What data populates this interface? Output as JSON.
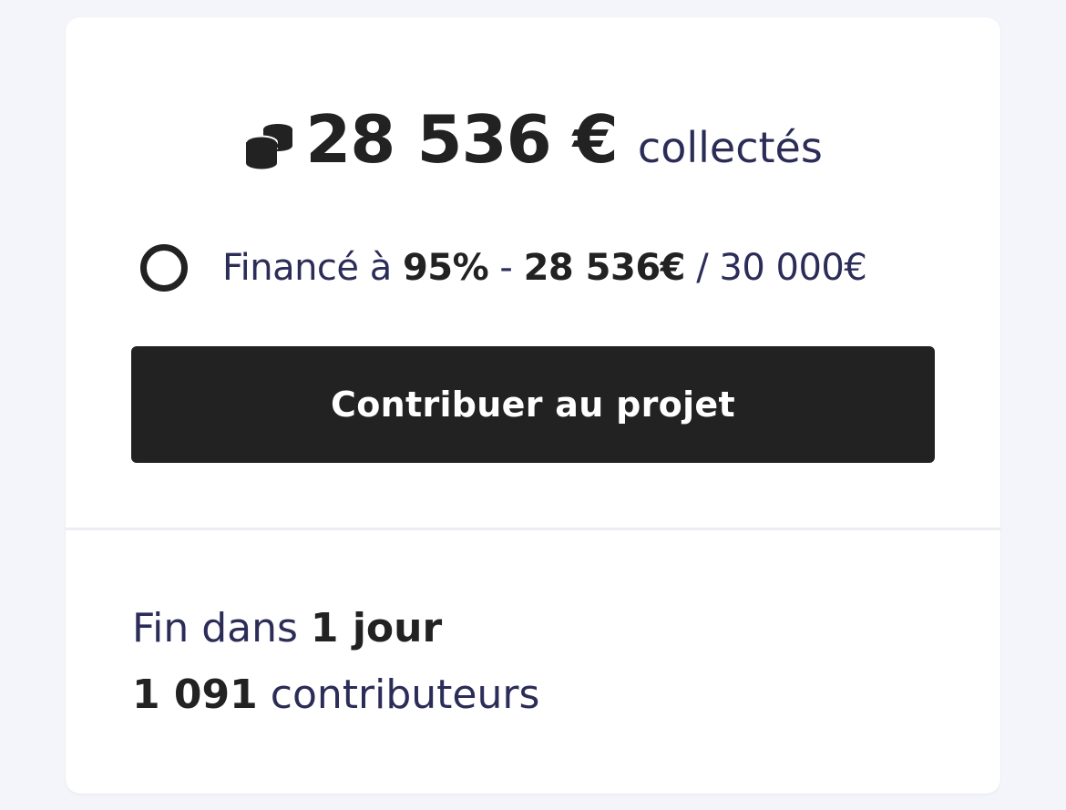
{
  "campaign": {
    "raised_amount": "28 536 €",
    "raised_suffix": "collectés",
    "coins_icon": "coins-icon",
    "funding": {
      "prefix": "Financé à ",
      "percent": "95%",
      "separator": " - ",
      "raised": "28 536€",
      "slash": " / ",
      "goal": "30 000€",
      "progress_percent": 95
    },
    "cta_label": "Contribuer au projet",
    "end": {
      "prefix": "Fin dans ",
      "value": "1 jour"
    },
    "contributors": {
      "count": "1 091",
      "label": " contributeurs"
    }
  },
  "colors": {
    "background": "#f4f5fa",
    "card": "#ffffff",
    "text_dark": "#222222",
    "text_navy": "#2b2d58",
    "button": "#222222",
    "button_text": "#ffffff"
  }
}
